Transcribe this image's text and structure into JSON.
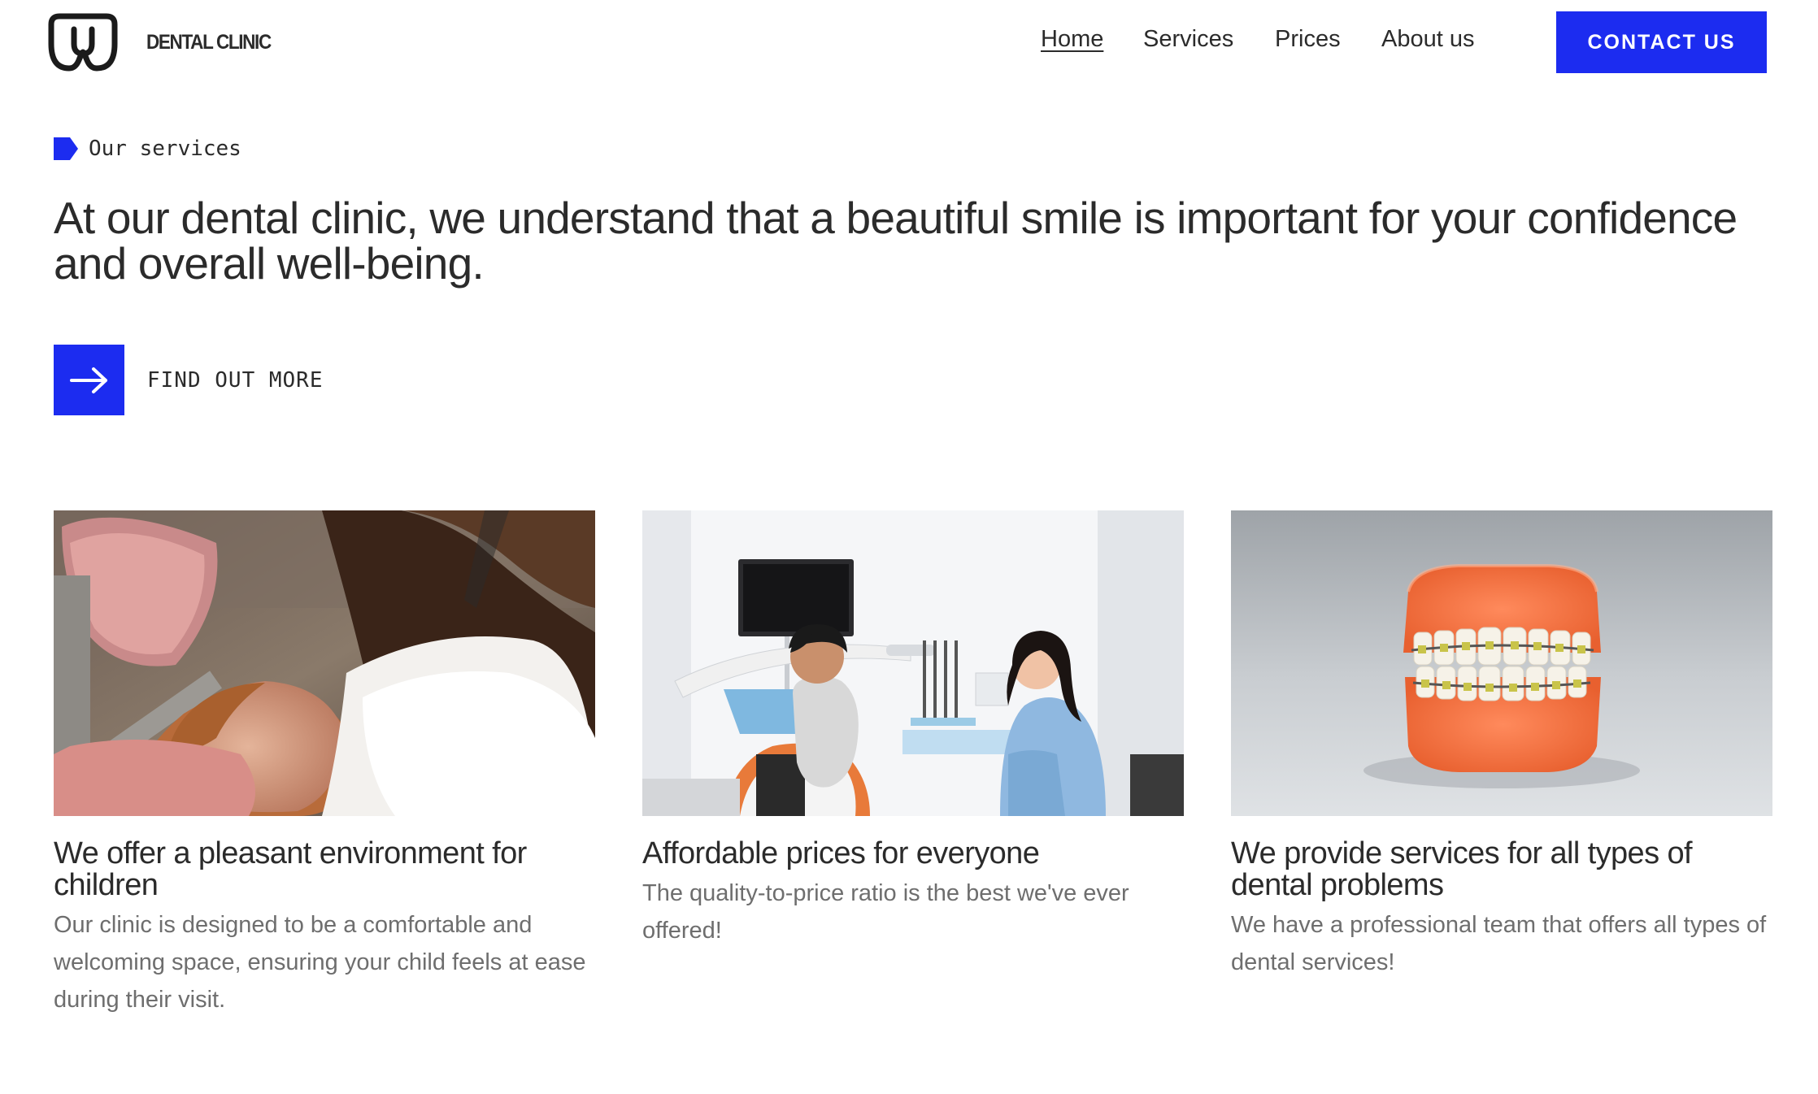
{
  "header": {
    "brand": "DENTAL CLINIC",
    "nav": [
      {
        "label": "Home",
        "active": true
      },
      {
        "label": "Services",
        "active": false
      },
      {
        "label": "Prices",
        "active": false
      },
      {
        "label": "About us",
        "active": false
      }
    ],
    "contact_label": "CONTACT US"
  },
  "intro": {
    "eyebrow": "Our services",
    "headline": "At our dental clinic, we understand that a beautiful smile is important for your confidence and overall well-being.",
    "cta_label": "FIND OUT MORE"
  },
  "cards": [
    {
      "title": "We offer a pleasant environment for children",
      "text": "Our clinic is designed to be a comfortable and welcoming space, ensuring your child feels at ease during their visit.",
      "image": "child-dental-exam-photo"
    },
    {
      "title": "Affordable prices for everyone",
      "text": "The quality-to-price ratio is the best we've ever offered!",
      "image": "dentist-consultation-photo"
    },
    {
      "title": "We provide services for all types of dental problems",
      "text": "We have a professional team that offers all types of dental services!",
      "image": "braces-dental-model-photo"
    }
  ],
  "colors": {
    "accent": "#1c2cf0",
    "text": "#2b2b2b",
    "muted": "#6e6e6e",
    "background": "#ffffff"
  }
}
